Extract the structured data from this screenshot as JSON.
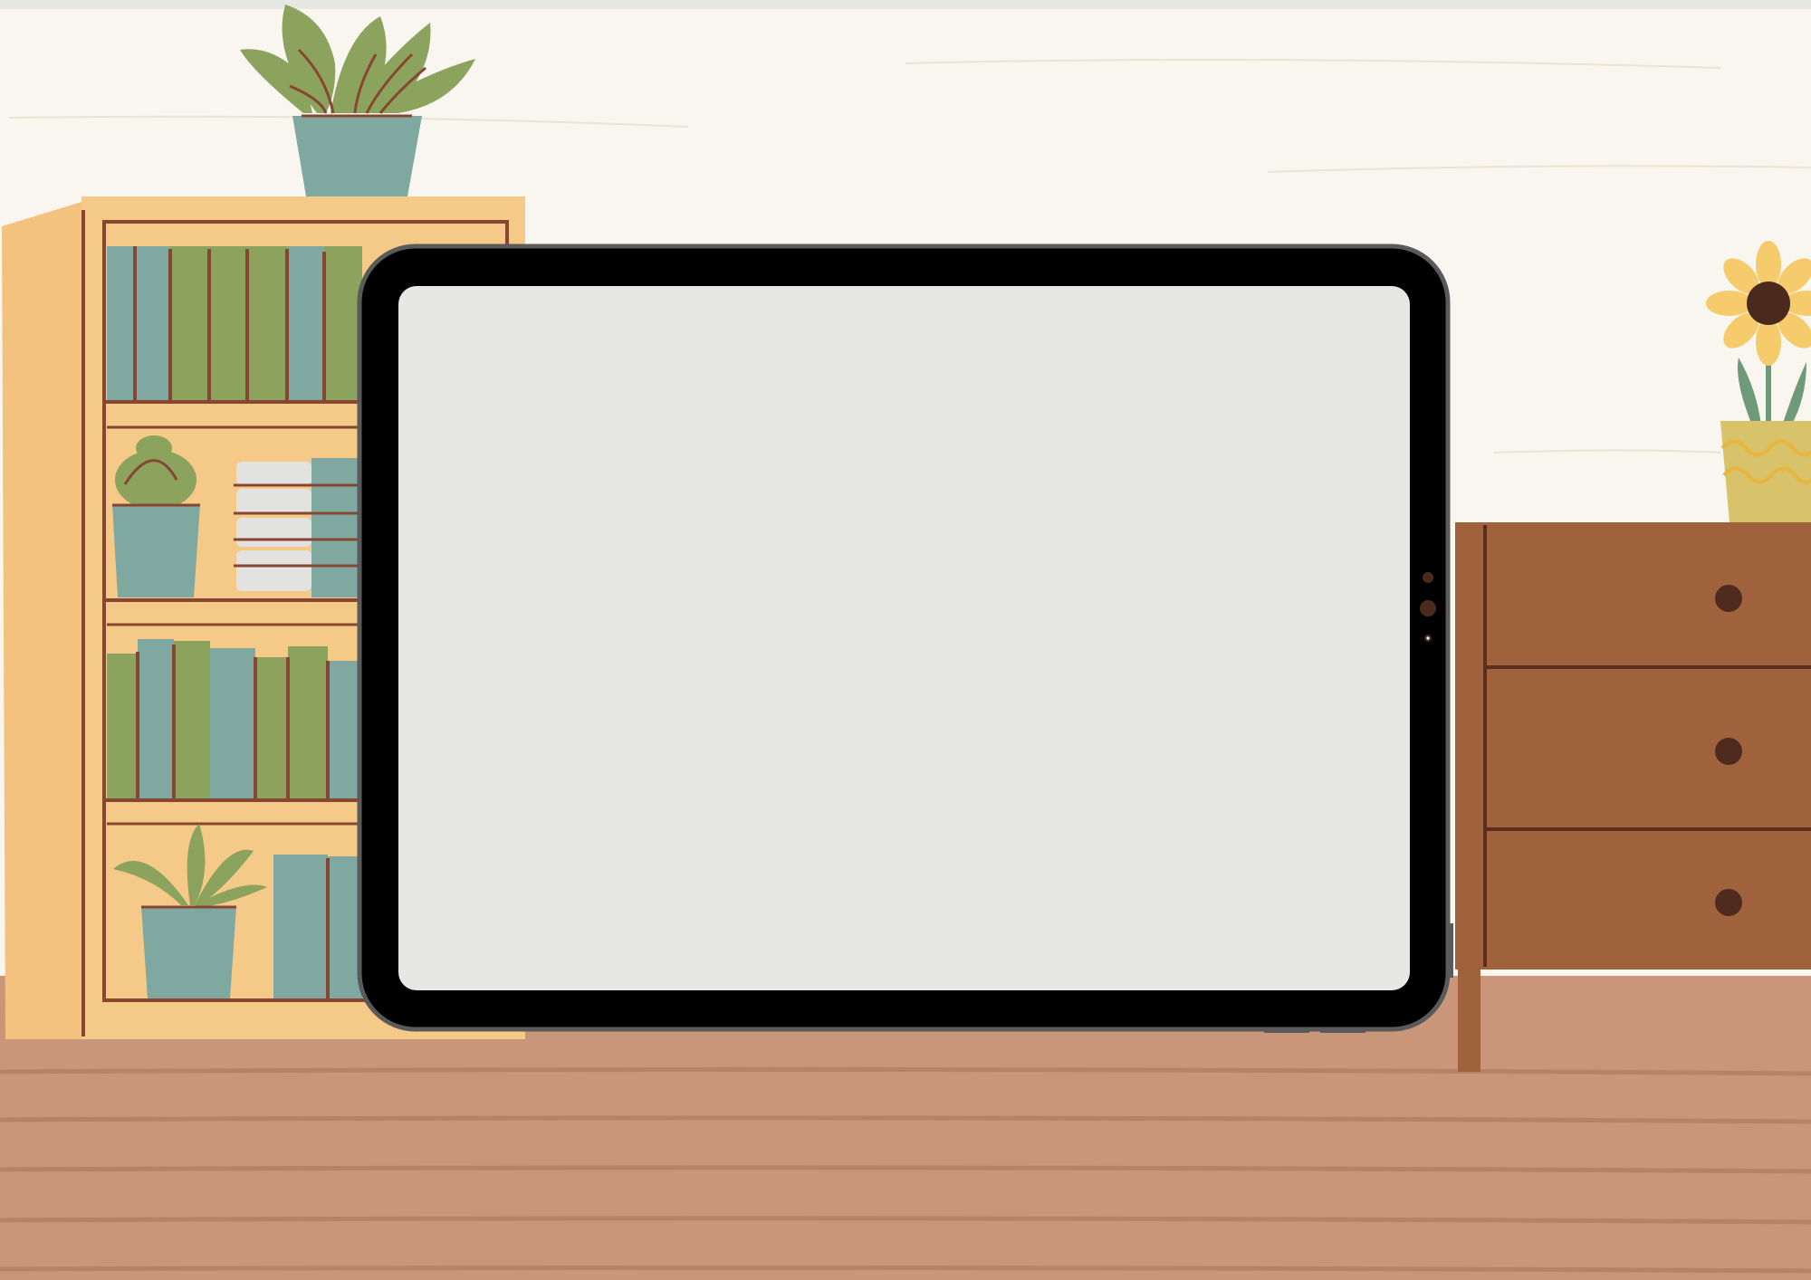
{
  "scene": {
    "colors": {
      "top_band": "#e7e8e4",
      "wall": "#f9f6f0",
      "floor": "#c9967a",
      "floor_lines": "#b8826a",
      "bookshelf": "#f5c987",
      "bookshelf_side": "#f3c27e",
      "outline": "#874632",
      "book_teal": "#7fa8a0",
      "book_green": "#8ba35d",
      "book_white": "#e2e2e0",
      "tablet_bezel": "#000000",
      "tablet_edge": "#5a5a5a",
      "tablet_screen": "#e7e8e4",
      "dresser": "#a0623c",
      "dresser_knob": "#4f2a1e",
      "sunflower_petal": "#f5cb6b",
      "sunflower_center": "#4a2a1c",
      "flower_pot": "#d8c36a"
    }
  }
}
